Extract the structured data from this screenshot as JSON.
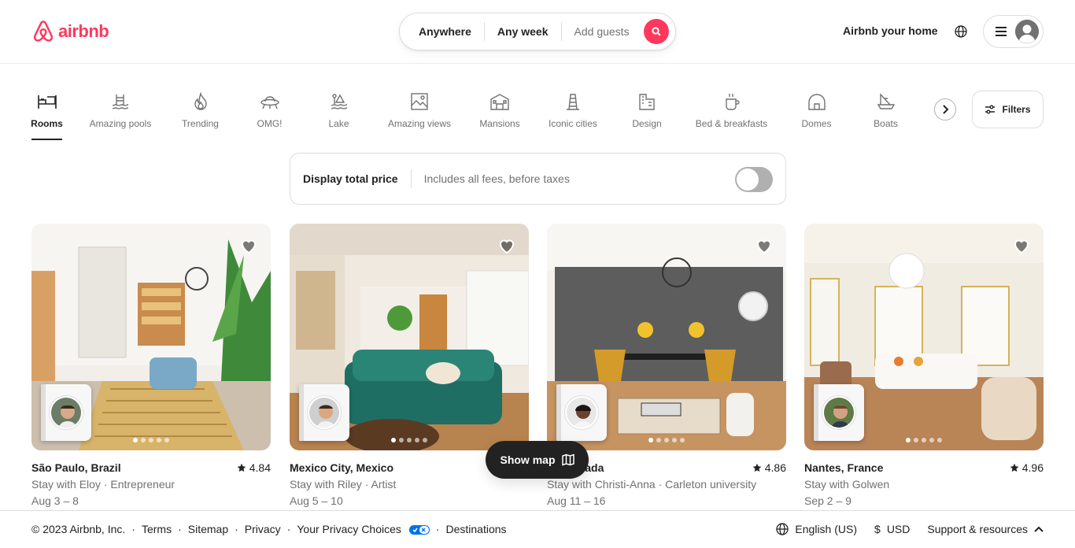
{
  "brand": {
    "name": "airbnb",
    "color": "#FF385C"
  },
  "search": {
    "anywhere": "Anywhere",
    "any_week": "Any week",
    "add_guests": "Add guests"
  },
  "header": {
    "host_link": "Airbnb your home"
  },
  "categories": [
    {
      "label": "Rooms",
      "icon": "rooms-icon",
      "active": true
    },
    {
      "label": "Amazing pools",
      "icon": "pool-icon"
    },
    {
      "label": "Trending",
      "icon": "flame-icon"
    },
    {
      "label": "OMG!",
      "icon": "ufo-icon"
    },
    {
      "label": "Lake",
      "icon": "lake-icon"
    },
    {
      "label": "Amazing views",
      "icon": "views-icon"
    },
    {
      "label": "Mansions",
      "icon": "mansion-icon"
    },
    {
      "label": "Iconic cities",
      "icon": "city-icon"
    },
    {
      "label": "Design",
      "icon": "design-icon"
    },
    {
      "label": "Bed & breakfasts",
      "icon": "breakfast-icon"
    },
    {
      "label": "Domes",
      "icon": "dome-icon"
    },
    {
      "label": "Boats",
      "icon": "boat-icon"
    }
  ],
  "filters_label": "Filters",
  "price_toggle": {
    "title": "Display total price",
    "subtitle": "Includes all fees, before taxes",
    "on": false
  },
  "listings": [
    {
      "location": "São Paulo, Brazil",
      "rating": "4.84",
      "desc": "Stay with Eloy · Entrepreneur",
      "dates": "Aug 3 – 8"
    },
    {
      "location": "Mexico City, Mexico",
      "rating": "",
      "desc": "Stay with Riley · Artist",
      "dates": "Aug 5 – 10"
    },
    {
      "location": "…, Canada",
      "rating": "4.86",
      "desc": "Stay with Christi-Anna · Carleton university",
      "dates": "Aug 11 – 16"
    },
    {
      "location": "Nantes, France",
      "rating": "4.96",
      "desc": "Stay with Golwen",
      "dates": "Sep 2 – 9"
    }
  ],
  "show_map": "Show map",
  "footer": {
    "copyright": "© 2023 Airbnb, Inc.",
    "links": [
      "Terms",
      "Sitemap",
      "Privacy",
      "Your Privacy Choices",
      "Destinations"
    ],
    "language": "English (US)",
    "currency_symbol": "$",
    "currency": "USD",
    "support": "Support & resources"
  }
}
